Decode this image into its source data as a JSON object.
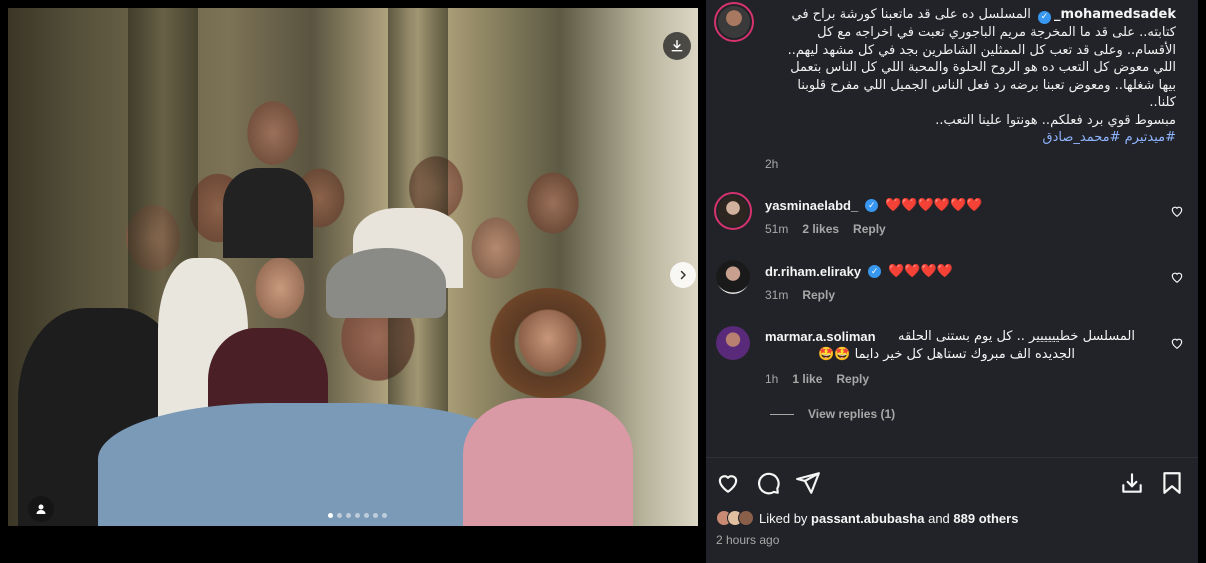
{
  "post": {
    "author": "mohamedsadek_",
    "caption_lines": [
      "المسلسل ده على قد ماتعبنا كورشة براح في",
      "كتابته.. على قد ما المخرجة مريم الباجوري تعبت في اخراجه مع كل",
      "الأقسام.. وعلى قد تعب كل الممثلين الشاطرين بجد في كل مشهد ليهم..",
      "اللي معوض كل التعب ده هو الروح الحلوة والمحبة اللي كل الناس بتعمل",
      "بيها شغلها.. ومعوض تعبنا برضه رد فعل الناس الجميل اللي مفرح قلوبنا",
      "كلنا..",
      "مبسوط قوي برد فعلكم.. هونتوا علينا التعب.."
    ],
    "hashtags": "#ميدتيرم #محمد_صادق",
    "caption_time": "2h",
    "photo_dots": 7,
    "photo_active_dot": 0
  },
  "comments": [
    {
      "user": "yasminaelabd_",
      "verified": true,
      "text": "❤️❤️❤️❤️❤️❤️",
      "time": "51m",
      "likes": "2 likes",
      "reply": "Reply"
    },
    {
      "user": "dr.riham.eliraky",
      "verified": true,
      "text": "❤️❤️❤️❤️",
      "time": "31m",
      "likes": "",
      "reply": "Reply"
    },
    {
      "user": "marmar.a.soliman",
      "verified": false,
      "text_line1": "المسلسل خطيييييير .. كل يوم بستنى الحلقه",
      "text_line2": "الجديده الف مبروك تستاهل كل خير دايما 🤩🤩",
      "time": "1h",
      "likes": "1 like",
      "reply": "Reply",
      "view_replies": "View replies (1)"
    }
  ],
  "footer": {
    "liked_by_prefix": "Liked by ",
    "liked_by_user": "passant.abubasha",
    "liked_by_and": " and ",
    "liked_by_count": "889 others",
    "posted": "2 hours ago"
  },
  "colors": {
    "panel_bg": "#212328",
    "muted": "#a8a8a8",
    "link": "#8fb4ff",
    "verified": "#3897f0",
    "heart": "#e0245e"
  }
}
